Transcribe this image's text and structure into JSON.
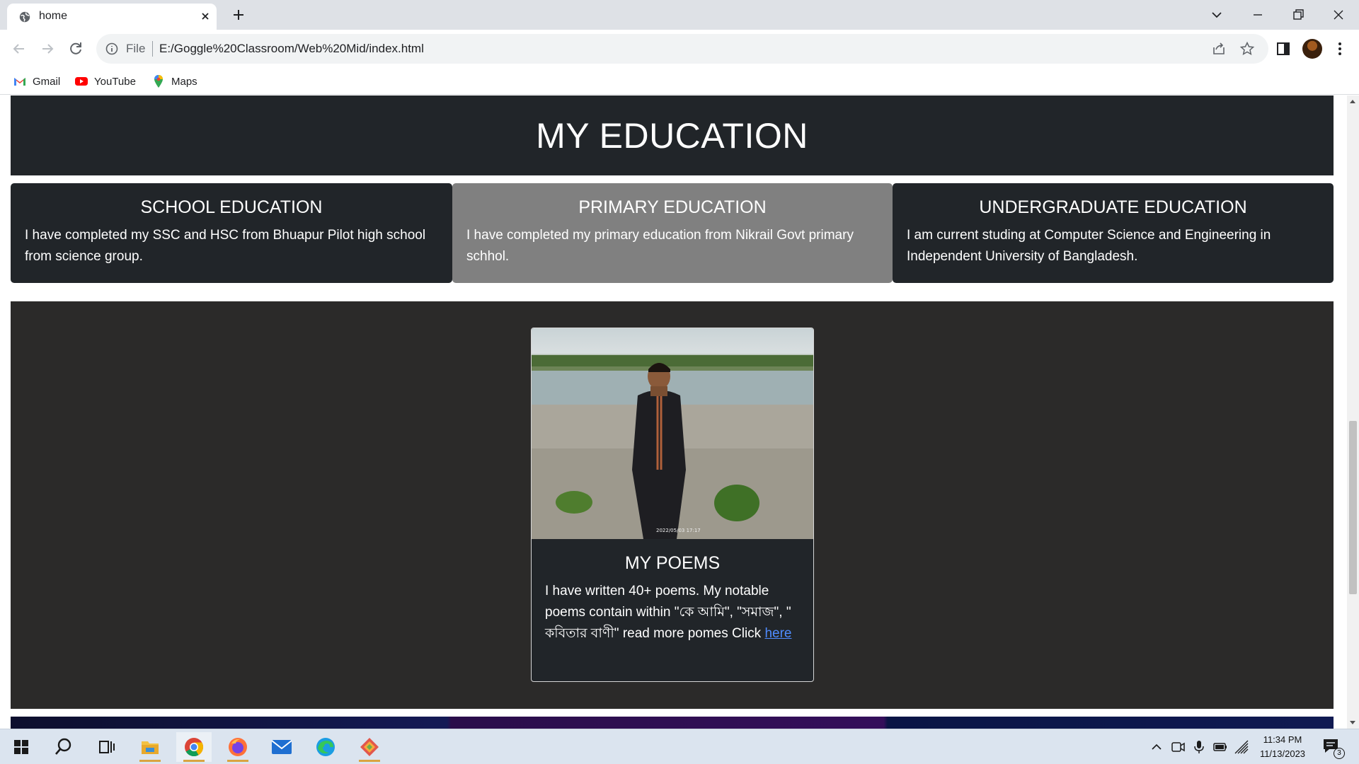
{
  "browser": {
    "tab_title": "home",
    "url_scheme": "File",
    "url": "E:/Goggle%20Classroom/Web%20Mid/index.html",
    "bookmarks": [
      "Gmail",
      "YouTube",
      "Maps"
    ]
  },
  "page": {
    "education_title": "MY EDUCATION",
    "cards": [
      {
        "title": "SCHOOL EDUCATION",
        "text": "I have completed my SSC and HSC from Bhuapur Pilot high school from science group."
      },
      {
        "title": "PRIMARY EDUCATION",
        "text": "I have completed my primary education from Nikrail Govt primary schhol."
      },
      {
        "title": "UNDERGRADUATE EDUCATION",
        "text": "I am current studing at Computer Science and Engineering in Independent University of Bangladesh."
      }
    ],
    "poem_card": {
      "title": "MY POEMS",
      "text": "I have written 40+ poems. My notable poems contain within \"কে আমি\", \"সমাজ\", \" কবিতার বাণী\" read more pomes Click ",
      "link_text": "here",
      "photo_stamp": "2022/05/03 17:17"
    }
  },
  "taskbar": {
    "time": "11:34 PM",
    "date": "11/13/2023",
    "notification_count": "3"
  },
  "colors": {
    "dark_card": "#212529",
    "gray_card": "#808080",
    "poem_section_bg": "#2b2a29",
    "link": "#4f8cff"
  }
}
